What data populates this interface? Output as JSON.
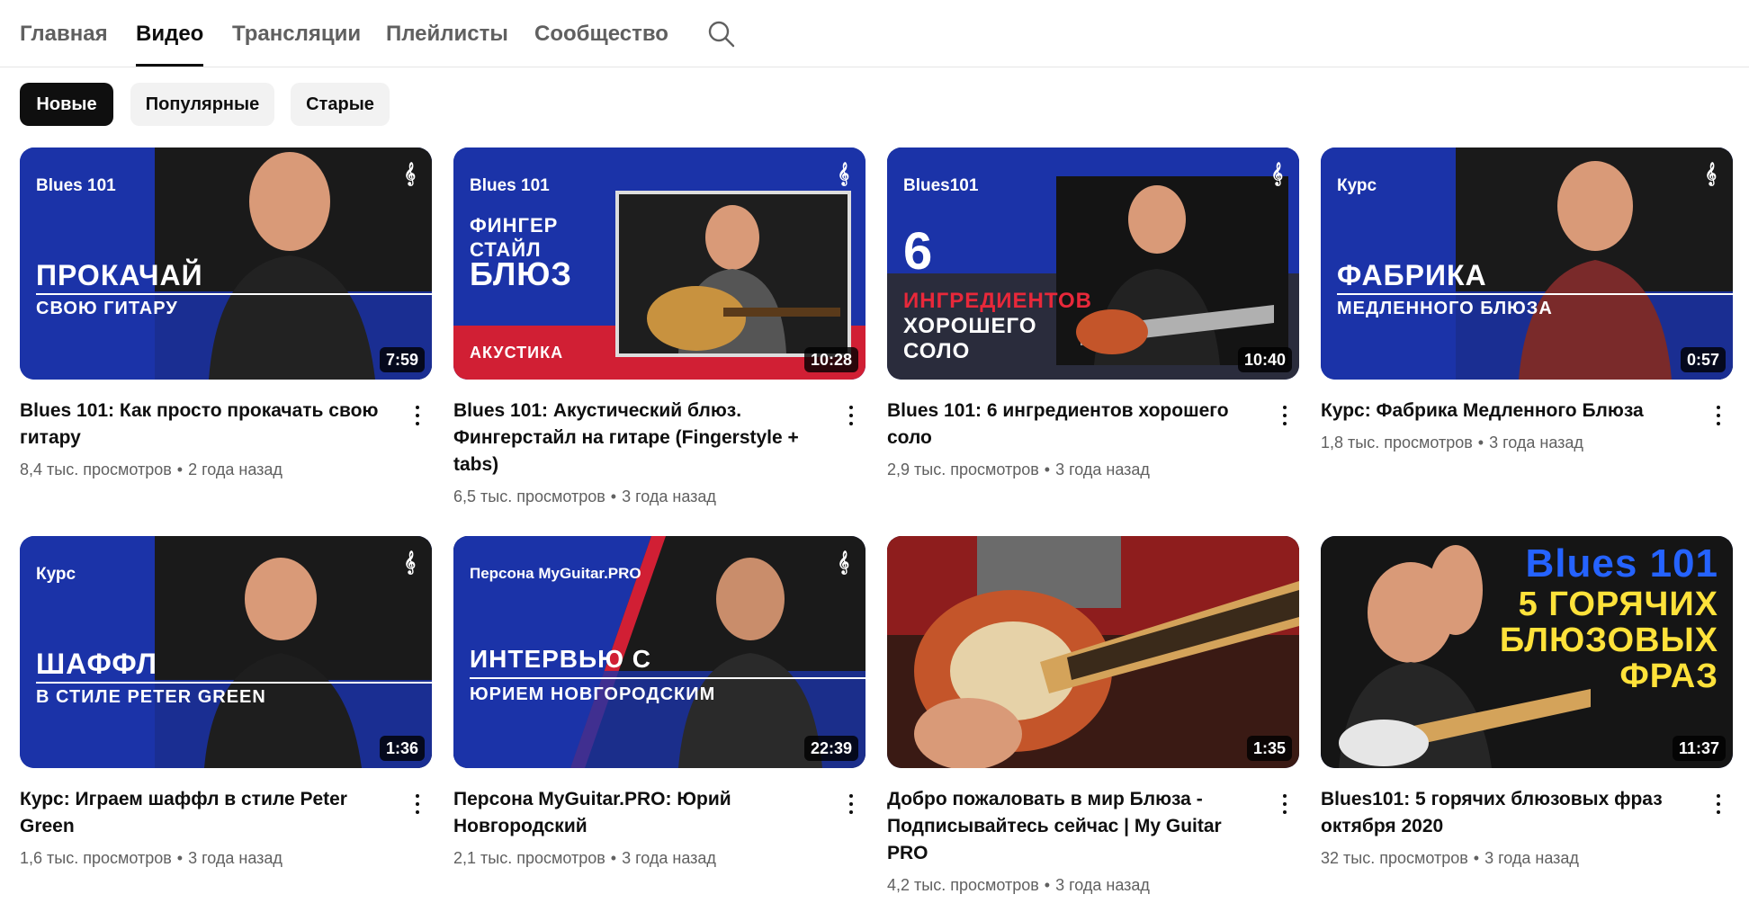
{
  "tabs": [
    {
      "label": "Главная"
    },
    {
      "label": "Видео"
    },
    {
      "label": "Трансляции"
    },
    {
      "label": "Плейлисты"
    },
    {
      "label": "Сообщество"
    }
  ],
  "active_tab": "Видео",
  "chips": [
    {
      "label": "Новые",
      "active": true
    },
    {
      "label": "Популярные",
      "active": false
    },
    {
      "label": "Старые",
      "active": false
    }
  ],
  "videos": [
    {
      "title": "Blues 101: Как просто прокачать свою гитару",
      "views": "8,4 тыс. просмотров",
      "age": "2 года назад",
      "duration": "7:59",
      "thumb": {
        "brand": "Blues 101",
        "big": "ПРОКАЧАЙ",
        "sub": "СВОЮ ГИТАРУ"
      }
    },
    {
      "title": "Blues 101: Акустический блюз. Фингерстайл на гитаре (Fingerstyle + tabs)",
      "views": "6,5 тыс. просмотров",
      "age": "3 года назад",
      "duration": "10:28",
      "thumb": {
        "brand": "Blues 101",
        "line1": "ФИНГЕР",
        "line2": "СТАЙЛ",
        "big": "БЛЮЗ",
        "sub": "АКУСТИКА"
      }
    },
    {
      "title": "Blues 101: 6 ингредиентов хорошего соло",
      "views": "2,9 тыс. просмотров",
      "age": "3 года назад",
      "duration": "10:40",
      "thumb": {
        "brand": "Blues101",
        "num": "6",
        "red": "ИНГРЕДИЕНТОВ",
        "line1": "ХОРОШЕГО",
        "line2": "СОЛО"
      }
    },
    {
      "title": "Курс: Фабрика Медленного Блюза",
      "views": "1,8 тыс. просмотров",
      "age": "3 года назад",
      "duration": "0:57",
      "thumb": {
        "brand": "Курс",
        "big": "ФАБРИКА",
        "sub": "МЕДЛЕННОГО БЛЮЗА"
      }
    },
    {
      "title": "Курс: Играем шаффл в стиле Peter Green",
      "views": "1,6 тыс. просмотров",
      "age": "3 года назад",
      "duration": "1:36",
      "thumb": {
        "brand": "Курс",
        "big": "ШАФФЛ",
        "sub": "В СТИЛЕ PETER GREEN"
      }
    },
    {
      "title": "Персона MyGuitar.PRO: Юрий Новгородский",
      "views": "2,1 тыс. просмотров",
      "age": "3 года назад",
      "duration": "22:39",
      "thumb": {
        "brand": "Персона MyGuitar.PRO",
        "big": "ИНТЕРВЬЮ С",
        "sub": "ЮРИЕМ НОВГОРОДСКИМ"
      }
    },
    {
      "title": "Добро пожаловать в мир Блюза - Подписывайтесь сейчас | My Guitar PRO",
      "views": "4,2 тыс. просмотров",
      "age": "3 года назад",
      "duration": "1:35",
      "thumb": {}
    },
    {
      "title": "Blues101: 5 горячих блюзовых фраз октября 2020",
      "views": "32 тыс. просмотров",
      "age": "3 года назад",
      "duration": "11:37",
      "thumb": {
        "brand": "Blues 101",
        "line1": "5 ГОРЯЧИХ",
        "line2": "БЛЮЗОВЫХ",
        "line3": "ФРАЗ"
      }
    }
  ],
  "colors": {
    "brand_blue": "#1b33a8",
    "brand_red": "#d11f34",
    "dark": "#0f0f0f",
    "muted": "#606060"
  },
  "icons": {
    "search": "search-icon",
    "menu": "more-vert-icon",
    "logo": "channel-logo-icon"
  }
}
